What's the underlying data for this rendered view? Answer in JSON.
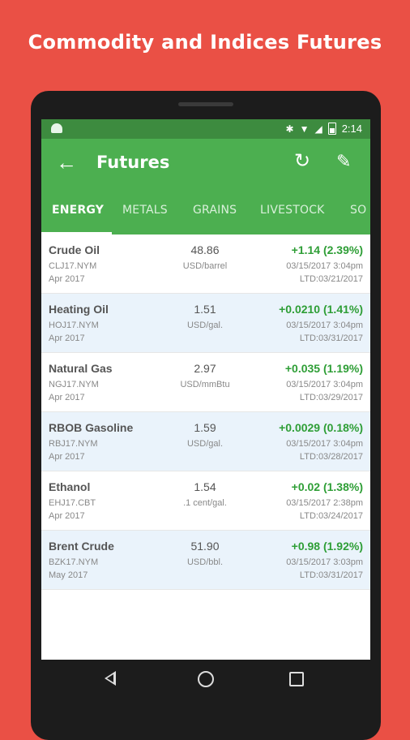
{
  "headline": "Commodity and Indices Futures",
  "status_bar": {
    "time": "2:14"
  },
  "toolbar": {
    "back_icon": "arrow-left-icon",
    "title": "Futures",
    "refresh_icon": "refresh-icon",
    "edit_icon": "pencil-icon"
  },
  "tabs": [
    {
      "label": "ENERGY",
      "active": true
    },
    {
      "label": "METALS"
    },
    {
      "label": "GRAINS"
    },
    {
      "label": "LIVESTOCK"
    },
    {
      "label": "SO"
    }
  ],
  "accent_color": "#4caf50",
  "up_color": "#2e9e36",
  "rows": [
    {
      "name": "Crude Oil",
      "symbol": "CLJ17.NYM",
      "month": "Apr 2017",
      "price": "48.86",
      "unit": "USD/barrel",
      "change": "+1.14 (2.39%)",
      "time": "03/15/2017 3:04pm",
      "ltd": "LTD:03/21/2017"
    },
    {
      "name": "Heating Oil",
      "symbol": "HOJ17.NYM",
      "month": "Apr 2017",
      "price": "1.51",
      "unit": "USD/gal.",
      "change": "+0.0210 (1.41%)",
      "time": "03/15/2017 3:04pm",
      "ltd": "LTD:03/31/2017"
    },
    {
      "name": "Natural Gas",
      "symbol": "NGJ17.NYM",
      "month": "Apr 2017",
      "price": "2.97",
      "unit": "USD/mmBtu",
      "change": "+0.035 (1.19%)",
      "time": "03/15/2017 3:04pm",
      "ltd": "LTD:03/29/2017"
    },
    {
      "name": "RBOB Gasoline",
      "symbol": "RBJ17.NYM",
      "month": "Apr 2017",
      "price": "1.59",
      "unit": "USD/gal.",
      "change": "+0.0029 (0.18%)",
      "time": "03/15/2017 3:04pm",
      "ltd": "LTD:03/28/2017"
    },
    {
      "name": "Ethanol",
      "symbol": "EHJ17.CBT",
      "month": "Apr 2017",
      "price": "1.54",
      "unit": ".1 cent/gal.",
      "change": "+0.02 (1.38%)",
      "time": "03/15/2017 2:38pm",
      "ltd": "LTD:03/24/2017"
    },
    {
      "name": "Brent Crude",
      "symbol": "BZK17.NYM",
      "month": "May 2017",
      "price": "51.90",
      "unit": "USD/bbl.",
      "change": "+0.98 (1.92%)",
      "time": "03/15/2017 3:03pm",
      "ltd": "LTD:03/31/2017"
    }
  ]
}
